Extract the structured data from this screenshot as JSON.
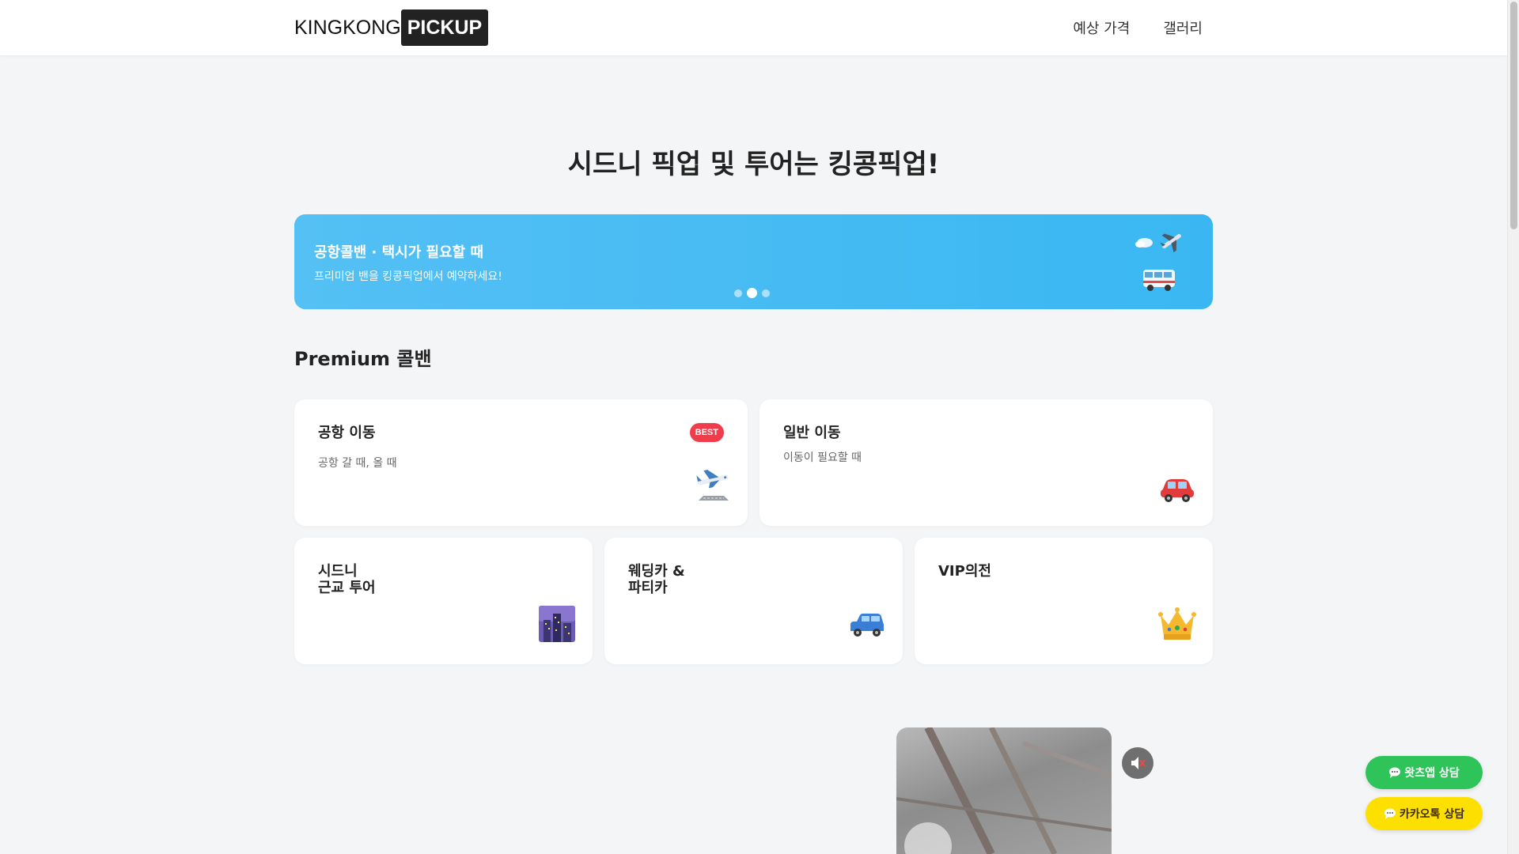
{
  "header": {
    "logo_text": "KINGKONG",
    "logo_box": "PICKUP",
    "nav": [
      "예상 가격",
      "갤러리"
    ]
  },
  "hero": {
    "title": "시드니 픽업 및 투어는 킹콩픽업!"
  },
  "banner": {
    "title": "공항콜밴 · 택시가 필요할 때",
    "subtitle": "프리미엄 밴을 킹콩픽업에서 예약하세요!",
    "icon": "airplane-van-icon",
    "slide_count": 3,
    "active_slide": 2,
    "background": "#48bdf3"
  },
  "section": {
    "title": "Premium 콜밴"
  },
  "cards": [
    {
      "title": "공항 이동",
      "desc": "공항 갈 때, 올 때",
      "badge": "BEST",
      "icon": "airplane-icon"
    },
    {
      "title": "일반 이동",
      "desc": "이동이 필요할 때",
      "icon": "car-icon"
    },
    {
      "title": "시드니\n근교 투어",
      "icon": "city-night-icon"
    },
    {
      "title": "웨딩카 &\n파티카",
      "icon": "suv-icon"
    },
    {
      "title": "VIP의전",
      "icon": "crown-icon"
    }
  ],
  "media": {
    "mute_icon": "muted-speaker-icon"
  },
  "chat": {
    "whatsapp_label": "왓츠앱 상담",
    "kakao_label": "카카오톡 상담",
    "whatsapp_color": "#2fc45a",
    "kakao_color": "#fde000"
  }
}
